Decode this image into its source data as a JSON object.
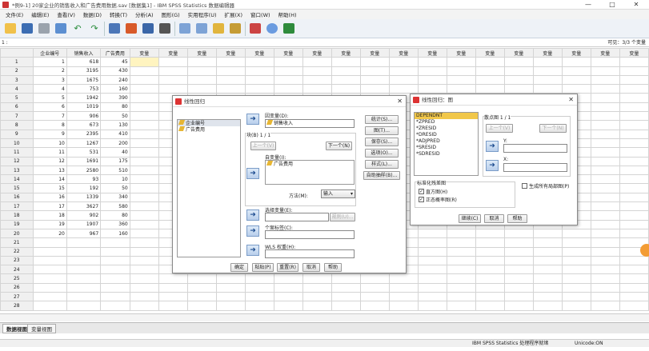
{
  "window": {
    "title": "*例9-1] 20家企业的销售收入和广告费用数据.sav [数据集1] - IBM SPSS Statistics 数据编辑器",
    "min": "—",
    "max": "□",
    "close": "✕"
  },
  "menu": [
    "文件(E)",
    "编辑(E)",
    "查看(V)",
    "数据(D)",
    "转换(T)",
    "分析(A)",
    "图形(G)",
    "实用程序(U)",
    "扩展(X)",
    "窗口(W)",
    "帮助(H)"
  ],
  "toolbar_icons": [
    "open-icon",
    "save-icon",
    "print-icon",
    "recall-dialog-icon",
    "undo-icon",
    "redo-icon",
    "goto-case-icon",
    "goto-variable-icon",
    "variables-icon",
    "find-icon",
    "insert-cases-icon",
    "insert-variable-icon",
    "split-file-icon",
    "weight-cases-icon",
    "select-cases-icon",
    "value-labels-icon",
    "use-sets-icon"
  ],
  "cellref": {
    "label": "1 :",
    "visible": "可见：3/3 个变量"
  },
  "grid": {
    "columns": [
      "企业编号",
      "销售收入",
      "广告费用",
      "变量",
      "变量",
      "变量",
      "变量",
      "变量",
      "变量",
      "变量",
      "变量",
      "变量",
      "变量",
      "变量",
      "变量",
      "变量",
      "变量",
      "变量",
      "变量",
      "变量",
      "变量"
    ],
    "rows": [
      [
        "1",
        "1",
        "618",
        "45"
      ],
      [
        "2",
        "2",
        "3195",
        "430"
      ],
      [
        "3",
        "3",
        "1675",
        "240"
      ],
      [
        "4",
        "4",
        "753",
        "160"
      ],
      [
        "5",
        "5",
        "1942",
        "390"
      ],
      [
        "6",
        "6",
        "1019",
        "80"
      ],
      [
        "7",
        "7",
        "906",
        "50"
      ],
      [
        "8",
        "8",
        "673",
        "130"
      ],
      [
        "9",
        "9",
        "2395",
        "410"
      ],
      [
        "10",
        "10",
        "1267",
        "200"
      ],
      [
        "11",
        "11",
        "531",
        "40"
      ],
      [
        "12",
        "12",
        "1691",
        "175"
      ],
      [
        "13",
        "13",
        "2580",
        "510"
      ],
      [
        "14",
        "14",
        "93",
        "10"
      ],
      [
        "15",
        "15",
        "192",
        "50"
      ],
      [
        "16",
        "16",
        "1339",
        "340"
      ],
      [
        "17",
        "17",
        "3627",
        "580"
      ],
      [
        "18",
        "18",
        "902",
        "80"
      ],
      [
        "19",
        "19",
        "1907",
        "360"
      ],
      [
        "20",
        "20",
        "967",
        "160"
      ],
      [
        "21",
        "",
        "",
        ""
      ],
      [
        "22",
        "",
        "",
        ""
      ],
      [
        "23",
        "",
        "",
        ""
      ],
      [
        "24",
        "",
        "",
        ""
      ],
      [
        "25",
        "",
        "",
        ""
      ],
      [
        "26",
        "",
        "",
        ""
      ],
      [
        "27",
        "",
        "",
        ""
      ],
      [
        "28",
        "",
        "",
        ""
      ]
    ]
  },
  "tabs": {
    "data_view": "数据视图",
    "variable_view": "变量视图"
  },
  "status": {
    "processor": "IBM SPSS Statistics 处理程序就绪",
    "unicode": "Unicode:ON"
  },
  "linreg": {
    "title": "线性回归",
    "source_vars": [
      "企业编号",
      "广告费用"
    ],
    "dependent_label": "因变量(D):",
    "dependent_value": "销售收入",
    "block_label": "块(B) 1 / 1",
    "prev_btn": "上一个(V)",
    "next_btn": "下一个(N)",
    "independents_label": "自变量(I):",
    "independents": [
      "广告费用"
    ],
    "method_label": "方法(M):",
    "method_value": "输入",
    "selection_label": "选择变量(E):",
    "rule_btn": "规则(U)...",
    "case_label_label": "个案标签(C):",
    "wls_label": "WLS 权重(H):",
    "side_buttons": [
      "统计(S)...",
      "图(T)...",
      "保存(S)...",
      "选项(O)...",
      "样式(L)...",
      "自助抽样(B)..."
    ],
    "bottom_buttons": [
      "确定",
      "粘贴(P)",
      "重置(R)",
      "取消",
      "帮助"
    ]
  },
  "plots": {
    "title": "线性回归：图",
    "vars": [
      "DEPENDNT",
      "*ZPRED",
      "*ZRESID",
      "*DRESID",
      "*ADJPRED",
      "*SRESID",
      "*SDRESID"
    ],
    "scatter_label": "散点图 1 / 1",
    "prev_btn": "上一个(V)",
    "next_btn": "下一个(N)",
    "y_label": "Y:",
    "x_label": "X:",
    "std_group": "标准化残差图",
    "hist": "直方图(H)",
    "normal": "正态概率图(R)",
    "all_partial": "生成所有局部图(P)",
    "continue_btn": "继续(C)",
    "cancel_btn": "取消",
    "help_btn": "帮助"
  }
}
